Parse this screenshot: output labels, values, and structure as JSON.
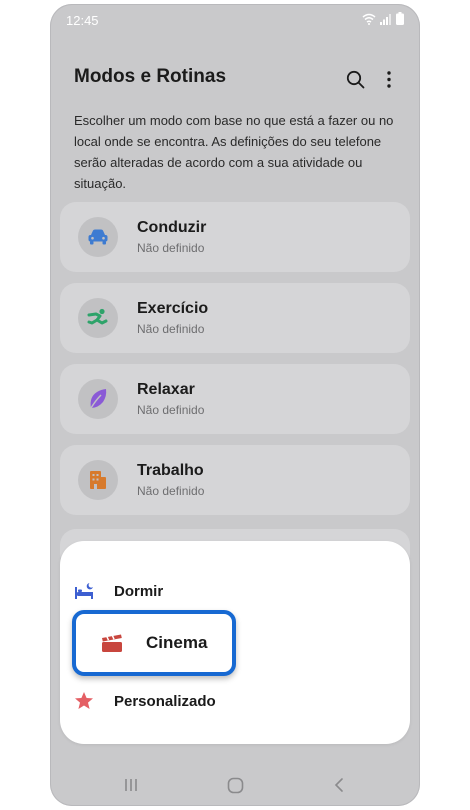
{
  "status_bar": {
    "time": "12:45"
  },
  "header": {
    "title": "Modos e Rotinas"
  },
  "description": "Escolher um modo com base no que está a fazer ou no local onde se encontra. As definições do seu telefone serão alteradas de acordo com a sua atividade ou situação.",
  "modes": [
    {
      "name": "Conduzir",
      "status": "Não definido",
      "icon": "car-icon",
      "color": "#3d7bd1"
    },
    {
      "name": "Exercício",
      "status": "Não definido",
      "icon": "running-icon",
      "color": "#2ea36a"
    },
    {
      "name": "Relaxar",
      "status": "Não definido",
      "icon": "leaf-icon",
      "color": "#8a5ad6"
    },
    {
      "name": "Trabalho",
      "status": "Não definido",
      "icon": "building-icon",
      "color": "#d77a2c"
    }
  ],
  "sheet": {
    "items": [
      {
        "label": "Dormir",
        "icon": "bed-moon-icon",
        "color": "#3d5fd1"
      },
      {
        "label": "Cinema",
        "icon": "clapperboard-icon",
        "color": "#c8463e"
      },
      {
        "label": "Personalizado",
        "icon": "star-icon",
        "color": "#e45f64"
      }
    ]
  },
  "highlight_color": "#1769d2"
}
